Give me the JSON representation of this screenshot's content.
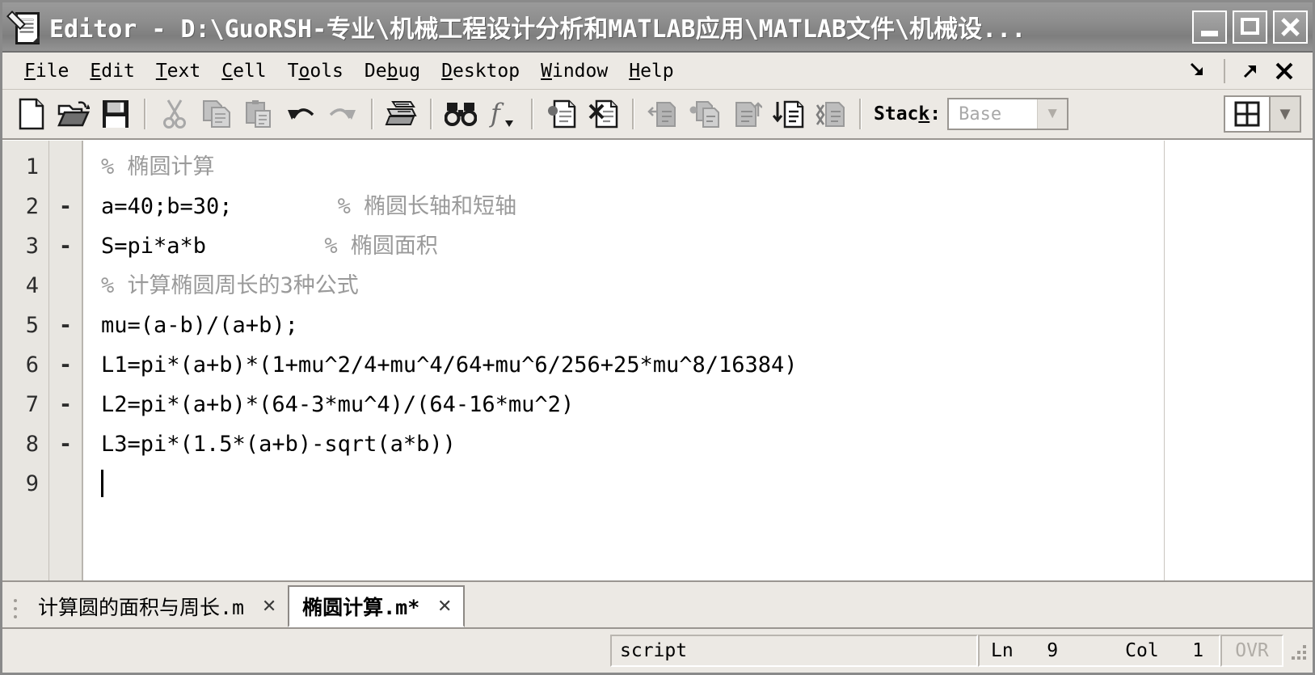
{
  "window": {
    "title": "Editor - D:\\GuoRSH-专业\\机械工程设计分析和MATLAB应用\\MATLAB文件\\机械设...",
    "icon": "document-pencil-icon",
    "caption_buttons": [
      {
        "name": "minimize",
        "glyph": "_"
      },
      {
        "name": "maximize",
        "glyph": "□"
      },
      {
        "name": "close",
        "glyph": "X"
      }
    ]
  },
  "menubar": {
    "items": [
      {
        "label": "File",
        "mnemonic": "F"
      },
      {
        "label": "Edit",
        "mnemonic": "E"
      },
      {
        "label": "Text",
        "mnemonic": "T"
      },
      {
        "label": "Cell",
        "mnemonic": "C"
      },
      {
        "label": "Tools",
        "mnemonic": "o"
      },
      {
        "label": "Debug",
        "mnemonic": "b"
      },
      {
        "label": "Desktop",
        "mnemonic": "D"
      },
      {
        "label": "Window",
        "mnemonic": "W"
      },
      {
        "label": "Help",
        "mnemonic": "H"
      }
    ],
    "right_controls": [
      {
        "name": "dock-arrow-icon",
        "glyph": "⬂"
      },
      {
        "name": "undock-arrow-icon",
        "glyph": "⬈"
      },
      {
        "name": "close-panel-icon",
        "glyph": "✕"
      }
    ]
  },
  "toolbar": {
    "buttons": [
      {
        "name": "new-file-button",
        "tip": "New",
        "enabled": true
      },
      {
        "name": "open-file-button",
        "tip": "Open",
        "enabled": true
      },
      {
        "name": "save-file-button",
        "tip": "Save",
        "enabled": true
      },
      {
        "name": "cut-button",
        "tip": "Cut",
        "enabled": false
      },
      {
        "name": "copy-button",
        "tip": "Copy",
        "enabled": false
      },
      {
        "name": "paste-button",
        "tip": "Paste",
        "enabled": false
      },
      {
        "name": "undo-button",
        "tip": "Undo",
        "enabled": true
      },
      {
        "name": "redo-button",
        "tip": "Redo",
        "enabled": false
      },
      {
        "name": "print-button",
        "tip": "Print",
        "enabled": true
      },
      {
        "name": "find-button",
        "tip": "Find",
        "enabled": true
      },
      {
        "name": "function-browser-button",
        "tip": "Function Browser",
        "enabled": true
      },
      {
        "name": "set-breakpoint-button",
        "tip": "Set/Clear Breakpoint",
        "enabled": true
      },
      {
        "name": "clear-breakpoints-button",
        "tip": "Clear Breakpoints",
        "enabled": true
      },
      {
        "name": "step-button",
        "tip": "Step",
        "enabled": false
      },
      {
        "name": "step-in-button",
        "tip": "Step In",
        "enabled": false
      },
      {
        "name": "step-out-button",
        "tip": "Step Out",
        "enabled": false
      },
      {
        "name": "continue-button",
        "tip": "Continue",
        "enabled": true
      },
      {
        "name": "exit-debug-button",
        "tip": "Exit Debug Mode",
        "enabled": false
      }
    ],
    "stack": {
      "label": "Stack:",
      "mnemonic": "k",
      "value": "Base",
      "enabled": false
    },
    "layout": {
      "name": "tile-layout-button",
      "arrow": "▼"
    }
  },
  "editor": {
    "lines": [
      {
        "num": "1",
        "mark": "",
        "code": "% 椭圆计算",
        "comment_from": 0
      },
      {
        "num": "2",
        "mark": "-",
        "code": "a=40;b=30;        % 椭圆长轴和短轴",
        "comment_from": 18
      },
      {
        "num": "3",
        "mark": "-",
        "code": "S=pi*a*b         % 椭圆面积",
        "comment_from": 17
      },
      {
        "num": "4",
        "mark": "",
        "code": "% 计算椭圆周长的3种公式",
        "comment_from": 0
      },
      {
        "num": "5",
        "mark": "-",
        "code": "mu=(a-b)/(a+b);",
        "comment_from": -1
      },
      {
        "num": "6",
        "mark": "-",
        "code": "L1=pi*(a+b)*(1+mu^2/4+mu^4/64+mu^6/256+25*mu^8/16384)",
        "comment_from": -1
      },
      {
        "num": "7",
        "mark": "-",
        "code": "L2=pi*(a+b)*(64-3*mu^4)/(64-16*mu^2)",
        "comment_from": -1
      },
      {
        "num": "8",
        "mark": "-",
        "code": "L3=pi*(1.5*(a+b)-sqrt(a*b))",
        "comment_from": -1
      },
      {
        "num": "9",
        "mark": "",
        "code": "",
        "comment_from": -1,
        "caret": true
      }
    ],
    "comment_color": "#9a9a9a",
    "text_color": "#000000"
  },
  "tabs": [
    {
      "label": "计算圆的面积与周长.m",
      "active": false,
      "close": "✕"
    },
    {
      "label": "椭圆计算.m*",
      "active": true,
      "close": "✕"
    }
  ],
  "statusbar": {
    "file_type": "script",
    "position": "Ln   9      Col   1",
    "overwrite": "OVR"
  }
}
